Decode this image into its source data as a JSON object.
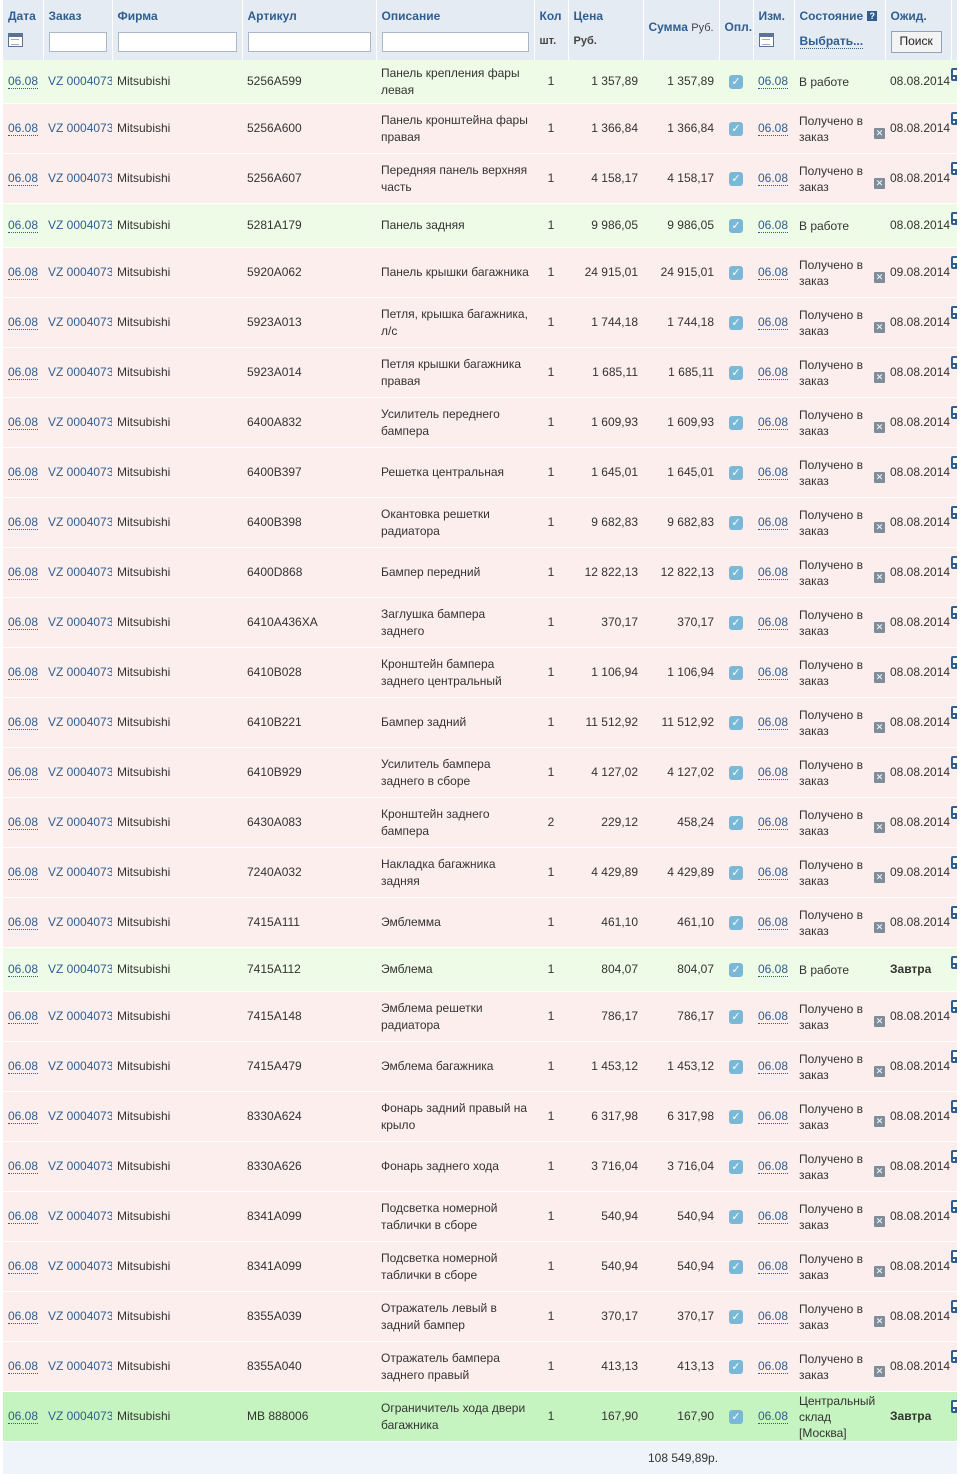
{
  "header": {
    "date": "Дата",
    "order": "Заказ",
    "firm": "Фирма",
    "article": "Артикул",
    "description": "Описание",
    "qty": "Кол",
    "qty_unit": "шт.",
    "price": "Цена",
    "price_unit": "Руб.",
    "sum": "Сумма",
    "sum_unit": "Руб.",
    "paid": "Опл.",
    "changed": "Изм.",
    "state": "Состояние",
    "state_select": "Выбрать...",
    "expected": "Ожид.",
    "search_button": "Поиск"
  },
  "rows": [
    {
      "date": "06.08",
      "order": "VZ 0004073",
      "firm": "Mitsubishi",
      "article": "5256A599",
      "desc": "Панель крепления фары левая",
      "qty": "1",
      "price": "1 357,89",
      "sum": "1 357,89",
      "changed": "06.08",
      "state": "В работе",
      "expected": "08.08.2014",
      "kind": "work"
    },
    {
      "date": "06.08",
      "order": "VZ 0004073",
      "firm": "Mitsubishi",
      "article": "5256A600",
      "desc": "Панель кронштейна фары правая",
      "qty": "1",
      "price": "1 366,84",
      "sum": "1 366,84",
      "changed": "06.08",
      "state": "Получено в заказ",
      "expected": "08.08.2014",
      "kind": "recv"
    },
    {
      "date": "06.08",
      "order": "VZ 0004073",
      "firm": "Mitsubishi",
      "article": "5256A607",
      "desc": "Передняя панель верхняя часть",
      "qty": "1",
      "price": "4 158,17",
      "sum": "4 158,17",
      "changed": "06.08",
      "state": "Получено в заказ",
      "expected": "08.08.2014",
      "kind": "recv"
    },
    {
      "date": "06.08",
      "order": "VZ 0004073",
      "firm": "Mitsubishi",
      "article": "5281A179",
      "desc": "Панель задняя",
      "qty": "1",
      "price": "9 986,05",
      "sum": "9 986,05",
      "changed": "06.08",
      "state": "В работе",
      "expected": "08.08.2014",
      "kind": "work"
    },
    {
      "date": "06.08",
      "order": "VZ 0004073",
      "firm": "Mitsubishi",
      "article": "5920A062",
      "desc": "Панель крышки багажника",
      "qty": "1",
      "price": "24 915,01",
      "sum": "24 915,01",
      "changed": "06.08",
      "state": "Получено в заказ",
      "expected": "09.08.2014",
      "kind": "recv"
    },
    {
      "date": "06.08",
      "order": "VZ 0004073",
      "firm": "Mitsubishi",
      "article": "5923A013",
      "desc": "Петля, крышка багажника, л/с",
      "qty": "1",
      "price": "1 744,18",
      "sum": "1 744,18",
      "changed": "06.08",
      "state": "Получено в заказ",
      "expected": "08.08.2014",
      "kind": "recv"
    },
    {
      "date": "06.08",
      "order": "VZ 0004073",
      "firm": "Mitsubishi",
      "article": "5923A014",
      "desc": "Петля крышки багажника правая",
      "qty": "1",
      "price": "1 685,11",
      "sum": "1 685,11",
      "changed": "06.08",
      "state": "Получено в заказ",
      "expected": "08.08.2014",
      "kind": "recv"
    },
    {
      "date": "06.08",
      "order": "VZ 0004073",
      "firm": "Mitsubishi",
      "article": "6400A832",
      "desc": "Усилитель переднего бампера",
      "qty": "1",
      "price": "1 609,93",
      "sum": "1 609,93",
      "changed": "06.08",
      "state": "Получено в заказ",
      "expected": "08.08.2014",
      "kind": "recv"
    },
    {
      "date": "06.08",
      "order": "VZ 0004073",
      "firm": "Mitsubishi",
      "article": "6400B397",
      "desc": "Решетка центральная",
      "qty": "1",
      "price": "1 645,01",
      "sum": "1 645,01",
      "changed": "06.08",
      "state": "Получено в заказ",
      "expected": "08.08.2014",
      "kind": "recv"
    },
    {
      "date": "06.08",
      "order": "VZ 0004073",
      "firm": "Mitsubishi",
      "article": "6400B398",
      "desc": "Окантовка решетки радиатора",
      "qty": "1",
      "price": "9 682,83",
      "sum": "9 682,83",
      "changed": "06.08",
      "state": "Получено в заказ",
      "expected": "08.08.2014",
      "kind": "recv"
    },
    {
      "date": "06.08",
      "order": "VZ 0004073",
      "firm": "Mitsubishi",
      "article": "6400D868",
      "desc": "Бампер передний",
      "qty": "1",
      "price": "12 822,13",
      "sum": "12 822,13",
      "changed": "06.08",
      "state": "Получено в заказ",
      "expected": "08.08.2014",
      "kind": "recv"
    },
    {
      "date": "06.08",
      "order": "VZ 0004073",
      "firm": "Mitsubishi",
      "article": "6410A436XA",
      "desc": "Заглушка бампера заднего",
      "qty": "1",
      "price": "370,17",
      "sum": "370,17",
      "changed": "06.08",
      "state": "Получено в заказ",
      "expected": "08.08.2014",
      "kind": "recv"
    },
    {
      "date": "06.08",
      "order": "VZ 0004073",
      "firm": "Mitsubishi",
      "article": "6410B028",
      "desc": "Кронштейн бампера заднего центральный",
      "qty": "1",
      "price": "1 106,94",
      "sum": "1 106,94",
      "changed": "06.08",
      "state": "Получено в заказ",
      "expected": "08.08.2014",
      "kind": "recv"
    },
    {
      "date": "06.08",
      "order": "VZ 0004073",
      "firm": "Mitsubishi",
      "article": "6410B221",
      "desc": "Бампер задний",
      "qty": "1",
      "price": "11 512,92",
      "sum": "11 512,92",
      "changed": "06.08",
      "state": "Получено в заказ",
      "expected": "08.08.2014",
      "kind": "recv"
    },
    {
      "date": "06.08",
      "order": "VZ 0004073",
      "firm": "Mitsubishi",
      "article": "6410B929",
      "desc": "Усилитель бампера заднего в сборе",
      "qty": "1",
      "price": "4 127,02",
      "sum": "4 127,02",
      "changed": "06.08",
      "state": "Получено в заказ",
      "expected": "08.08.2014",
      "kind": "recv"
    },
    {
      "date": "06.08",
      "order": "VZ 0004073",
      "firm": "Mitsubishi",
      "article": "6430A083",
      "desc": "Кронштейн заднего бампера",
      "qty": "2",
      "price": "229,12",
      "sum": "458,24",
      "changed": "06.08",
      "state": "Получено в заказ",
      "expected": "08.08.2014",
      "kind": "recv"
    },
    {
      "date": "06.08",
      "order": "VZ 0004073",
      "firm": "Mitsubishi",
      "article": "7240A032",
      "desc": "Накладка багажника задняя",
      "qty": "1",
      "price": "4 429,89",
      "sum": "4 429,89",
      "changed": "06.08",
      "state": "Получено в заказ",
      "expected": "09.08.2014",
      "kind": "recv"
    },
    {
      "date": "06.08",
      "order": "VZ 0004073",
      "firm": "Mitsubishi",
      "article": "7415A111",
      "desc": "Эмблемма",
      "qty": "1",
      "price": "461,10",
      "sum": "461,10",
      "changed": "06.08",
      "state": "Получено в заказ",
      "expected": "08.08.2014",
      "kind": "recv"
    },
    {
      "date": "06.08",
      "order": "VZ 0004073",
      "firm": "Mitsubishi",
      "article": "7415A112",
      "desc": "Эмблема",
      "qty": "1",
      "price": "804,07",
      "sum": "804,07",
      "changed": "06.08",
      "state": "В работе",
      "expected": "Завтра",
      "kind": "work"
    },
    {
      "date": "06.08",
      "order": "VZ 0004073",
      "firm": "Mitsubishi",
      "article": "7415A148",
      "desc": "Эмблема решетки радиатора",
      "qty": "1",
      "price": "786,17",
      "sum": "786,17",
      "changed": "06.08",
      "state": "Получено в заказ",
      "expected": "08.08.2014",
      "kind": "recv"
    },
    {
      "date": "06.08",
      "order": "VZ 0004073",
      "firm": "Mitsubishi",
      "article": "7415A479",
      "desc": "Эмблема багажника",
      "qty": "1",
      "price": "1 453,12",
      "sum": "1 453,12",
      "changed": "06.08",
      "state": "Получено в заказ",
      "expected": "08.08.2014",
      "kind": "recv"
    },
    {
      "date": "06.08",
      "order": "VZ 0004073",
      "firm": "Mitsubishi",
      "article": "8330A624",
      "desc": "Фонарь задний правый на крыло",
      "qty": "1",
      "price": "6 317,98",
      "sum": "6 317,98",
      "changed": "06.08",
      "state": "Получено в заказ",
      "expected": "08.08.2014",
      "kind": "recv"
    },
    {
      "date": "06.08",
      "order": "VZ 0004073",
      "firm": "Mitsubishi",
      "article": "8330A626",
      "desc": "Фонарь заднего хода",
      "qty": "1",
      "price": "3 716,04",
      "sum": "3 716,04",
      "changed": "06.08",
      "state": "Получено в заказ",
      "expected": "08.08.2014",
      "kind": "recv"
    },
    {
      "date": "06.08",
      "order": "VZ 0004073",
      "firm": "Mitsubishi",
      "article": "8341A099",
      "desc": "Подсветка номерной таблички в сборе",
      "qty": "1",
      "price": "540,94",
      "sum": "540,94",
      "changed": "06.08",
      "state": "Получено в заказ",
      "expected": "08.08.2014",
      "kind": "recv"
    },
    {
      "date": "06.08",
      "order": "VZ 0004073",
      "firm": "Mitsubishi",
      "article": "8341A099",
      "desc": "Подсветка номерной таблички в сборе",
      "qty": "1",
      "price": "540,94",
      "sum": "540,94",
      "changed": "06.08",
      "state": "Получено в заказ",
      "expected": "08.08.2014",
      "kind": "recv"
    },
    {
      "date": "06.08",
      "order": "VZ 0004073",
      "firm": "Mitsubishi",
      "article": "8355A039",
      "desc": "Отражатель левый в задний бампер",
      "qty": "1",
      "price": "370,17",
      "sum": "370,17",
      "changed": "06.08",
      "state": "Получено в заказ",
      "expected": "08.08.2014",
      "kind": "recv"
    },
    {
      "date": "06.08",
      "order": "VZ 0004073",
      "firm": "Mitsubishi",
      "article": "8355A040",
      "desc": "Отражатель бампера заднего правый",
      "qty": "1",
      "price": "413,13",
      "sum": "413,13",
      "changed": "06.08",
      "state": "Получено в заказ",
      "expected": "08.08.2014",
      "kind": "recv"
    },
    {
      "date": "06.08",
      "order": "VZ 0004073",
      "firm": "Mitsubishi",
      "article": "MB 888006",
      "desc": "Ограничитель хода двери багажника",
      "qty": "1",
      "price": "167,90",
      "sum": "167,90",
      "changed": "06.08",
      "state": "Центральный склад [Москва]",
      "expected": "Завтра",
      "kind": "central"
    }
  ],
  "footer": {
    "total": "108 549,89р."
  },
  "colors": {
    "work": "#eefbe6",
    "recv": "#fdeeee",
    "central": "#c6f4c0",
    "header": "#e4ebf3",
    "link": "#2f5e8f"
  },
  "icons": {
    "calendar": "calendar-icon",
    "paid": "check-icon",
    "remove": "remove-icon",
    "delivery": "delivery-icon",
    "help": "help-icon"
  }
}
